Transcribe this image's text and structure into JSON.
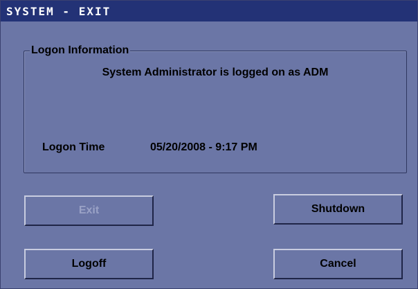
{
  "window": {
    "title": "SYSTEM - EXIT"
  },
  "logon_group": {
    "legend": "Logon Information",
    "logged_on_text": "System Administrator is logged on as ADM",
    "logon_time_label": "Logon Time",
    "logon_time_value": "05/20/2008 - 9:17 PM"
  },
  "buttons": {
    "exit": "Exit",
    "shutdown": "Shutdown",
    "logoff": "Logoff",
    "cancel": "Cancel"
  },
  "colors": {
    "title_bar": "#233276",
    "background": "#6b76a6",
    "disabled_text": "#9aa2c6"
  }
}
